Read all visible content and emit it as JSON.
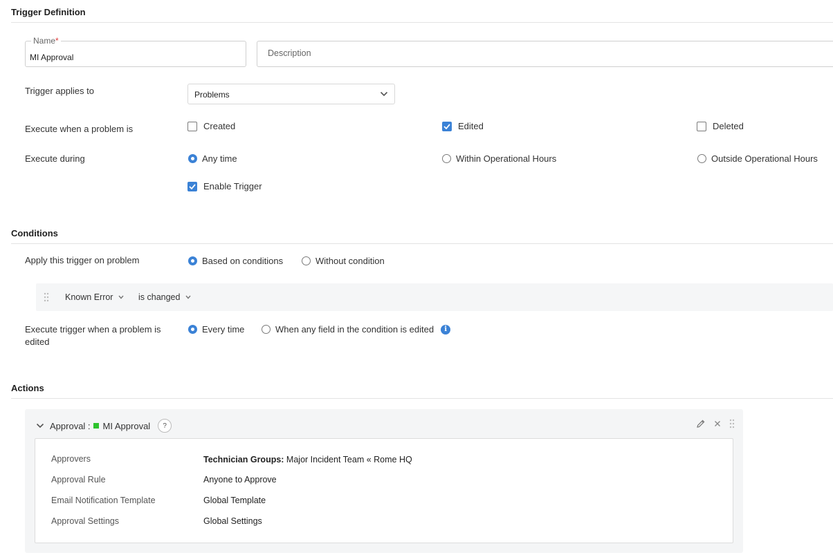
{
  "trigger_definition": {
    "title": "Trigger Definition",
    "name_label": "Name",
    "name_required_mark": "*",
    "name_value": "MI Approval",
    "description_placeholder": "Description",
    "applies_to_label": "Trigger applies to",
    "applies_to_value": "Problems",
    "execute_when_label": "Execute when a problem is",
    "execute_when_options": [
      {
        "label": "Created",
        "checked": false
      },
      {
        "label": "Edited",
        "checked": true
      },
      {
        "label": "Deleted",
        "checked": false
      }
    ],
    "execute_during_label": "Execute during",
    "execute_during_options": [
      {
        "label": "Any time",
        "selected": true
      },
      {
        "label": "Within Operational Hours",
        "selected": false
      },
      {
        "label": "Outside Operational Hours",
        "selected": false
      }
    ],
    "enable_trigger_label": "Enable Trigger",
    "enable_trigger_checked": true
  },
  "conditions": {
    "title": "Conditions",
    "apply_label": "Apply this trigger on problem",
    "apply_options": [
      {
        "label": "Based on conditions",
        "selected": true
      },
      {
        "label": "Without condition",
        "selected": false
      }
    ],
    "rule": {
      "field": "Known Error",
      "operator": "is changed"
    },
    "execute_edited_label_line1": "Execute trigger when a problem is",
    "execute_edited_label_line2": "edited",
    "execute_edited_options": [
      {
        "label": "Every time",
        "selected": true
      },
      {
        "label": "When any field in the condition is edited",
        "selected": false
      }
    ]
  },
  "actions": {
    "title": "Actions",
    "card": {
      "type_label": "Approval :",
      "name": "MI Approval",
      "help_icon_text": "?",
      "status_color": "#2ec32e",
      "rows": [
        {
          "key": "Approvers",
          "value_prefix": "Technician Groups:",
          "value": " Major Incident Team « Rome HQ"
        },
        {
          "key": "Approval Rule",
          "value_prefix": "",
          "value": "Anyone to Approve"
        },
        {
          "key": "Email Notification Template",
          "value_prefix": "",
          "value": "Global Template"
        },
        {
          "key": "Approval Settings",
          "value_prefix": "",
          "value": "Global Settings"
        }
      ]
    }
  },
  "colors": {
    "accent": "#3b82d6",
    "divider": "#e3e3e3",
    "card_bg": "#f4f5f6"
  },
  "icons": {
    "chevron": "chevron-down-icon",
    "info": "info-icon",
    "edit": "pencil-icon",
    "close": "close-icon",
    "drag": "drag-handle-icon"
  }
}
